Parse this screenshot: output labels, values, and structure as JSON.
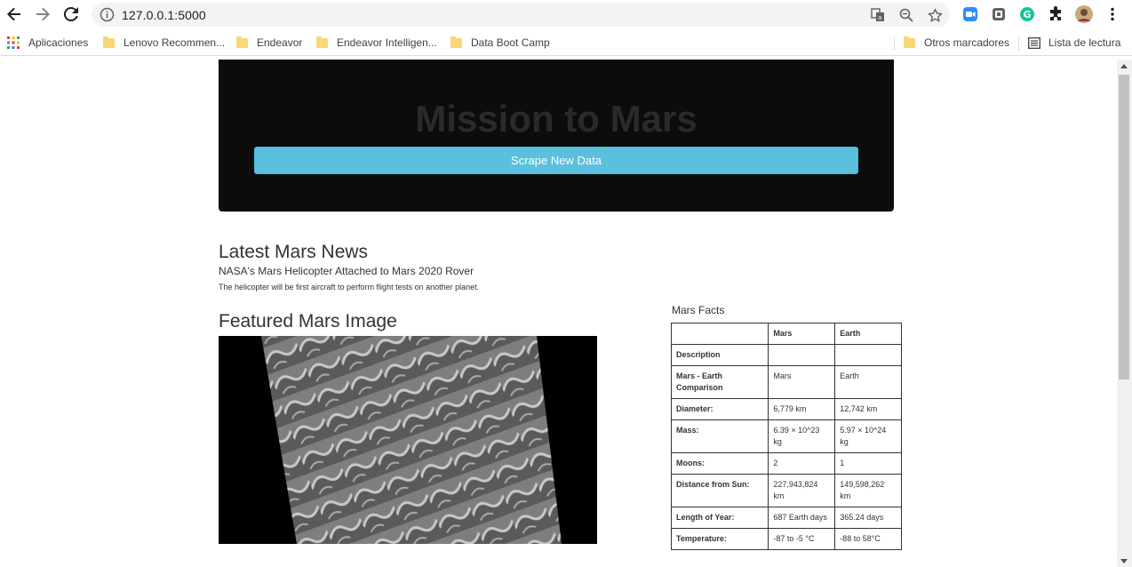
{
  "browser": {
    "url": "127.0.0.1:5000",
    "bookmarks": [
      {
        "label": "Aplicaciones",
        "icon": "apps-grid-icon"
      },
      {
        "label": "Lenovo Recommen...",
        "icon": "folder-icon"
      },
      {
        "label": "Endeavor",
        "icon": "folder-icon"
      },
      {
        "label": "Endeavor Intelligen...",
        "icon": "folder-icon"
      },
      {
        "label": "Data Boot Camp",
        "icon": "folder-icon"
      }
    ],
    "other_bookmarks": "Otros marcadores",
    "reading_list": "Lista de lectura"
  },
  "page": {
    "title": "Mission to Mars",
    "scrape_button": "Scrape New Data",
    "news": {
      "heading": "Latest Mars News",
      "title": "NASA's Mars Helicopter Attached to Mars 2020 Rover",
      "teaser": "The helicopter will be first aircraft to perform flight tests on another planet."
    },
    "featured_image": {
      "heading": "Featured Mars Image"
    },
    "facts": {
      "caption": "Mars Facts",
      "columns": [
        "",
        "Mars",
        "Earth"
      ],
      "rows": [
        [
          "Description",
          "",
          ""
        ],
        [
          "Mars - Earth Comparison",
          "Mars",
          "Earth"
        ],
        [
          "Diameter:",
          "6,779 km",
          "12,742 km"
        ],
        [
          "Mass:",
          "6.39 × 10^23 kg",
          "5.97 × 10^24 kg"
        ],
        [
          "Moons:",
          "2",
          "1"
        ],
        [
          "Distance from Sun:",
          "227,943,824 km",
          "149,598,262 km"
        ],
        [
          "Length of Year:",
          "687 Earth days",
          "365.24 days"
        ],
        [
          "Temperature:",
          "-87 to -5 °C",
          "-88 to 58°C"
        ]
      ]
    }
  },
  "colors": {
    "jumbotron_bg": "#0c0c0d",
    "button_bg": "#5bc0de"
  }
}
